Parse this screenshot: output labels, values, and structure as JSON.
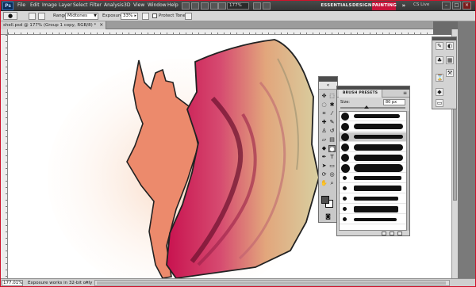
{
  "menubar": {
    "logo": "Ps",
    "items": [
      "File",
      "Edit",
      "Image",
      "Layer",
      "Select",
      "Filter",
      "Analysis",
      "3D",
      "View",
      "Window",
      "Help"
    ],
    "zoom": "177%",
    "workspaces": [
      "ESSENTIALS",
      "DESIGN",
      "PAINTING"
    ],
    "active_workspace": "PAINTING",
    "cs_live": "CS Live",
    "window_controls": [
      "–",
      "□",
      "×"
    ]
  },
  "options": {
    "range_label": "Range:",
    "range_value": "Midtones",
    "exposure_label": "Exposure:",
    "exposure_value": "33%",
    "protect_tones_label": "Protect Tones"
  },
  "document": {
    "tab_title": "shell.psd @ 177% (Group 1 copy, RGB/8) *",
    "close": "×"
  },
  "status": {
    "zoom": "177.01%",
    "info": "Exposure works in 32-bit only"
  },
  "brush_presets": {
    "tab_label": "BRUSH PRESETS",
    "size_label": "Size:",
    "size_value": "80 px"
  },
  "colors": {
    "accent": "#c8143a",
    "panel_bg": "#d4d4d4",
    "menubar_bg": "#3e3e3e"
  },
  "icons": {
    "tools": [
      "move-icon",
      "marquee-icon",
      "lasso-icon",
      "quick-select-icon",
      "crop-icon",
      "eyedropper-icon",
      "spot-heal-icon",
      "brush-icon",
      "clone-stamp-icon",
      "history-brush-icon",
      "eraser-icon",
      "gradient-icon",
      "blur-icon",
      "dodge-icon",
      "pen-icon",
      "type-icon",
      "path-select-icon",
      "shape-icon",
      "3d-rotate-icon",
      "3d-orbit-icon",
      "hand-icon",
      "zoom-icon"
    ]
  }
}
